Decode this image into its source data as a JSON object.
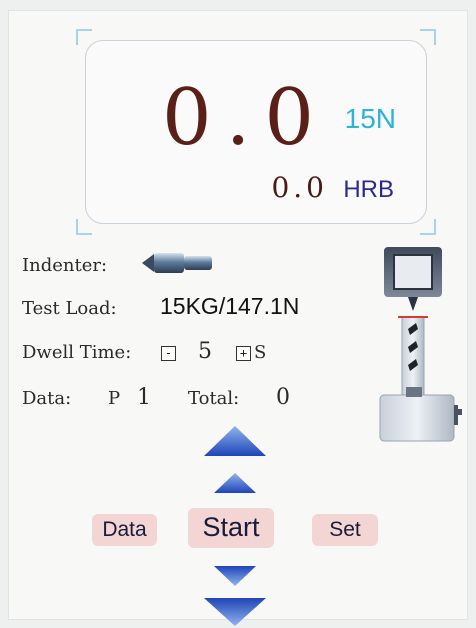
{
  "display": {
    "load_reading": "0.0",
    "load_unit": "15N",
    "hardness_reading": "0.0",
    "hardness_scale": "HRB"
  },
  "info": {
    "indenter_label": "Indenter:",
    "indenter_icon": "ball-indenter-icon",
    "test_load_label": "Test Load:",
    "test_load_value": "15KG/147.1N",
    "dwell_label": "Dwell Time:",
    "dwell_minus": "-",
    "dwell_value": "5",
    "dwell_plus": "+",
    "dwell_unit": "S",
    "data_label": "Data:",
    "data_p": "P",
    "data_index": "1",
    "total_label": "Total:",
    "total_value": "0"
  },
  "buttons": {
    "data_label": "Data",
    "start_label": "Start",
    "set_label": "Set"
  },
  "icons": {
    "arrow_up_large": "arrow-up-large-icon",
    "arrow_up_small": "arrow-up-small-icon",
    "arrow_down_small": "arrow-down-small-icon",
    "arrow_down_large": "arrow-down-large-icon",
    "machine": "hardness-tester-icon"
  },
  "colors": {
    "reading": "#5a1f17",
    "load_unit": "#2ab4d9",
    "scale_unit": "#2b2a8c",
    "arrow": "#2c56c8",
    "button_bg": "#f3d5d3"
  }
}
